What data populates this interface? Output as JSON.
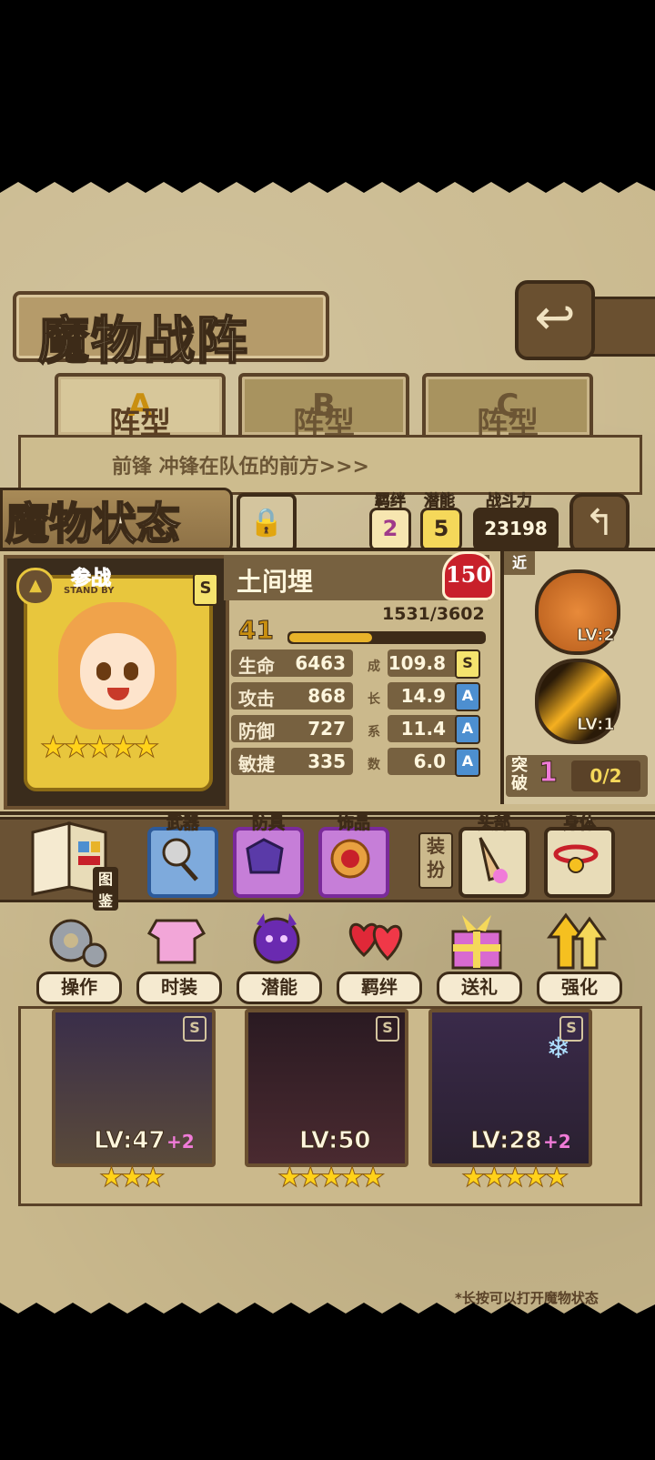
{
  "screen_title": "魔物战阵",
  "back_icon": "back-arrow-icon",
  "tabs": [
    {
      "prefix": "阵型",
      "letter": "A"
    },
    {
      "prefix": "阵型",
      "letter": "B"
    },
    {
      "prefix": "阵型",
      "letter": "C"
    }
  ],
  "formation_hint": "前锋 冲锋在队伍的前方>>>",
  "status": {
    "title": "魔物状态",
    "bond_label": "羁绊",
    "bond_value": "2",
    "potential_label": "潜能",
    "potential_value": "5",
    "power_label": "战斗力",
    "power_value": "23198"
  },
  "monster": {
    "standby": "参战",
    "standby_sub": "STAND BY",
    "rank": "S",
    "stars": "★★★★★",
    "name": "土间埋",
    "max_level_badge": "150",
    "level": "41",
    "exp_text": "1531/3602",
    "exp_fraction": 0.425,
    "growth_label_chars": [
      "成",
      "长",
      "系",
      "数"
    ],
    "stats": [
      {
        "label": "生命",
        "value": "6463",
        "growth": "109.8",
        "grade": "S"
      },
      {
        "label": "攻击",
        "value": "868",
        "growth": "14.9",
        "grade": "A"
      },
      {
        "label": "防御",
        "value": "727",
        "growth": "11.4",
        "grade": "A"
      },
      {
        "label": "敏捷",
        "value": "335",
        "growth": "6.0",
        "grade": "A"
      }
    ]
  },
  "skills": {
    "range_tag": "近",
    "skill1_lv": "LV:2",
    "skill2_lv": "LV:1",
    "break_label": "突破",
    "break_value": "1",
    "break_progress": "0/2"
  },
  "equipment": {
    "book_label": "图鉴",
    "weapon_label": "武器",
    "armor_label": "防具",
    "accessory_label": "饰品",
    "dress_label": "装扮",
    "head_label": "头部",
    "body_label": "身体"
  },
  "actions": [
    {
      "label": "操作",
      "icon": "gear-icon"
    },
    {
      "label": "时装",
      "icon": "outfit-icon"
    },
    {
      "label": "潜能",
      "icon": "potential-demon-icon"
    },
    {
      "label": "羁绊",
      "icon": "bond-hearts-icon"
    },
    {
      "label": "送礼",
      "icon": "gift-icon"
    },
    {
      "label": "强化",
      "icon": "upgrade-arrows-icon"
    }
  ],
  "roster": [
    {
      "level": "LV:47",
      "plus": "+2",
      "stars": "★★★",
      "rank": "S"
    },
    {
      "level": "LV:50",
      "plus": "",
      "stars": "★★★★★",
      "rank": "S"
    },
    {
      "level": "LV:28",
      "plus": "+2",
      "stars": "★★★★★",
      "rank": "S"
    }
  ],
  "footer_hint": "*长按可以打开魔物状态",
  "colors": {
    "bg": "#c9b88c",
    "frame": "#3d2b18",
    "accent_gold": "#e8c63d",
    "heart_red": "#c8202a",
    "grade_a_blue": "#4d8fd0",
    "pink": "#f07bd8"
  }
}
